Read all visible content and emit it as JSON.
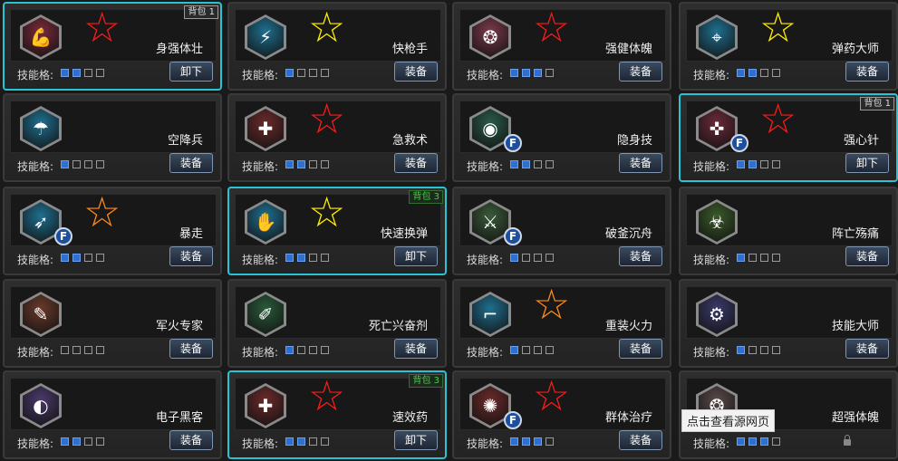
{
  "slots_label": "技能格:",
  "tooltip": "点击查看源网页",
  "cards": [
    {
      "name": "身强体壮",
      "slots_on": 2,
      "button": "卸下",
      "equipped": true,
      "bag": "背包 1",
      "bag_style": "white",
      "star": "red",
      "f": false,
      "icon": "muscle-icon",
      "hex_color": "#7a2a3a",
      "glyph": "💪"
    },
    {
      "name": "快枪手",
      "slots_on": 1,
      "button": "装备",
      "equipped": false,
      "bag": "",
      "bag_style": "",
      "star": "yellow",
      "f": false,
      "icon": "lightning-gun-icon",
      "hex_color": "#1f6f8f",
      "glyph": "⚡"
    },
    {
      "name": "强健体魄",
      "slots_on": 3,
      "button": "装备",
      "equipped": false,
      "bag": "",
      "bag_style": "",
      "star": "red",
      "f": false,
      "icon": "body-icon",
      "hex_color": "#7a3a4a",
      "glyph": "❂"
    },
    {
      "name": "弹药大师",
      "slots_on": 2,
      "button": "装备",
      "equipped": false,
      "bag": "",
      "bag_style": "",
      "star": "yellow",
      "f": false,
      "icon": "ammo-icon",
      "hex_color": "#1f6f8f",
      "glyph": "⌖"
    },
    {
      "name": "空降兵",
      "slots_on": 1,
      "button": "装备",
      "equipped": false,
      "bag": "",
      "bag_style": "",
      "star": "",
      "f": false,
      "icon": "parachute-icon",
      "hex_color": "#1f6f8f",
      "glyph": "☂"
    },
    {
      "name": "急救术",
      "slots_on": 2,
      "button": "装备",
      "equipped": false,
      "bag": "",
      "bag_style": "",
      "star": "red",
      "f": false,
      "icon": "first-aid-icon",
      "hex_color": "#6a2a2a",
      "glyph": "✚"
    },
    {
      "name": "隐身技",
      "slots_on": 2,
      "button": "装备",
      "equipped": false,
      "bag": "",
      "bag_style": "",
      "star": "",
      "f": true,
      "icon": "stealth-icon",
      "hex_color": "#2a5a4a",
      "glyph": "◉"
    },
    {
      "name": "强心针",
      "slots_on": 2,
      "button": "卸下",
      "equipped": true,
      "bag": "背包 1",
      "bag_style": "white",
      "star": "red",
      "f": true,
      "icon": "syringe-icon",
      "hex_color": "#6a2a3a",
      "glyph": "✜"
    },
    {
      "name": "暴走",
      "slots_on": 2,
      "button": "装备",
      "equipped": false,
      "bag": "",
      "bag_style": "",
      "star": "orange",
      "f": true,
      "icon": "rampage-icon",
      "hex_color": "#1f6f8f",
      "glyph": "➶"
    },
    {
      "name": "快速换弹",
      "slots_on": 2,
      "button": "卸下",
      "equipped": true,
      "bag": "背包 3",
      "bag_style": "green",
      "star": "yellow",
      "f": false,
      "icon": "reload-icon",
      "hex_color": "#1f6f8f",
      "glyph": "✋"
    },
    {
      "name": "破釜沉舟",
      "slots_on": 1,
      "button": "装备",
      "equipped": false,
      "bag": "",
      "bag_style": "",
      "star": "",
      "f": true,
      "icon": "last-stand-icon",
      "hex_color": "#3a5a3a",
      "glyph": "⚔"
    },
    {
      "name": "阵亡殇痛",
      "slots_on": 1,
      "button": "装备",
      "equipped": false,
      "bag": "",
      "bag_style": "",
      "star": "",
      "f": false,
      "icon": "biohazard-icon",
      "hex_color": "#3a5a2a",
      "glyph": "☣"
    },
    {
      "name": "军火专家",
      "slots_on": 0,
      "button": "装备",
      "equipped": false,
      "bag": "",
      "bag_style": "",
      "star": "",
      "f": false,
      "icon": "munitions-icon",
      "hex_color": "#6a3a2a",
      "glyph": "✎"
    },
    {
      "name": "死亡兴奋剂",
      "slots_on": 1,
      "button": "装备",
      "equipped": false,
      "bag": "",
      "bag_style": "",
      "star": "",
      "f": false,
      "icon": "stimulant-icon",
      "hex_color": "#2a5a3a",
      "glyph": "✐"
    },
    {
      "name": "重装火力",
      "slots_on": 1,
      "button": "装备",
      "equipped": false,
      "bag": "",
      "bag_style": "",
      "star": "orange",
      "f": false,
      "icon": "heavy-gun-icon",
      "hex_color": "#1f6f8f",
      "glyph": "⌐"
    },
    {
      "name": "技能大师",
      "slots_on": 1,
      "button": "装备",
      "equipped": false,
      "bag": "",
      "bag_style": "",
      "star": "",
      "f": false,
      "icon": "wrench-icon",
      "hex_color": "#3a3a6a",
      "glyph": "⚙"
    },
    {
      "name": "电子黑客",
      "slots_on": 2,
      "button": "装备",
      "equipped": false,
      "bag": "",
      "bag_style": "",
      "star": "",
      "f": false,
      "icon": "hacker-icon",
      "hex_color": "#4a3a6a",
      "glyph": "◐"
    },
    {
      "name": "速效药",
      "slots_on": 2,
      "button": "卸下",
      "equipped": true,
      "bag": "背包 3",
      "bag_style": "green",
      "star": "red",
      "f": false,
      "icon": "quick-medicine-icon",
      "hex_color": "#6a2a2a",
      "glyph": "✚"
    },
    {
      "name": "群体治疗",
      "slots_on": 3,
      "button": "装备",
      "equipped": false,
      "bag": "",
      "bag_style": "",
      "star": "red",
      "f": true,
      "icon": "group-heal-icon",
      "hex_color": "#6a2a2a",
      "glyph": "✺"
    },
    {
      "name": "超强体魄",
      "slots_on": 3,
      "button": "",
      "equipped": false,
      "bag": "",
      "bag_style": "",
      "star": "",
      "f": false,
      "icon": "super-body-icon",
      "hex_color": "#5a4a4a",
      "glyph": "❂",
      "locked": true
    }
  ],
  "star_colors": {
    "red": "#ff1a1a",
    "yellow": "#ffee00",
    "orange": "#ff8a1a"
  },
  "f_badge_text": "F",
  "star_glyph": "☆"
}
